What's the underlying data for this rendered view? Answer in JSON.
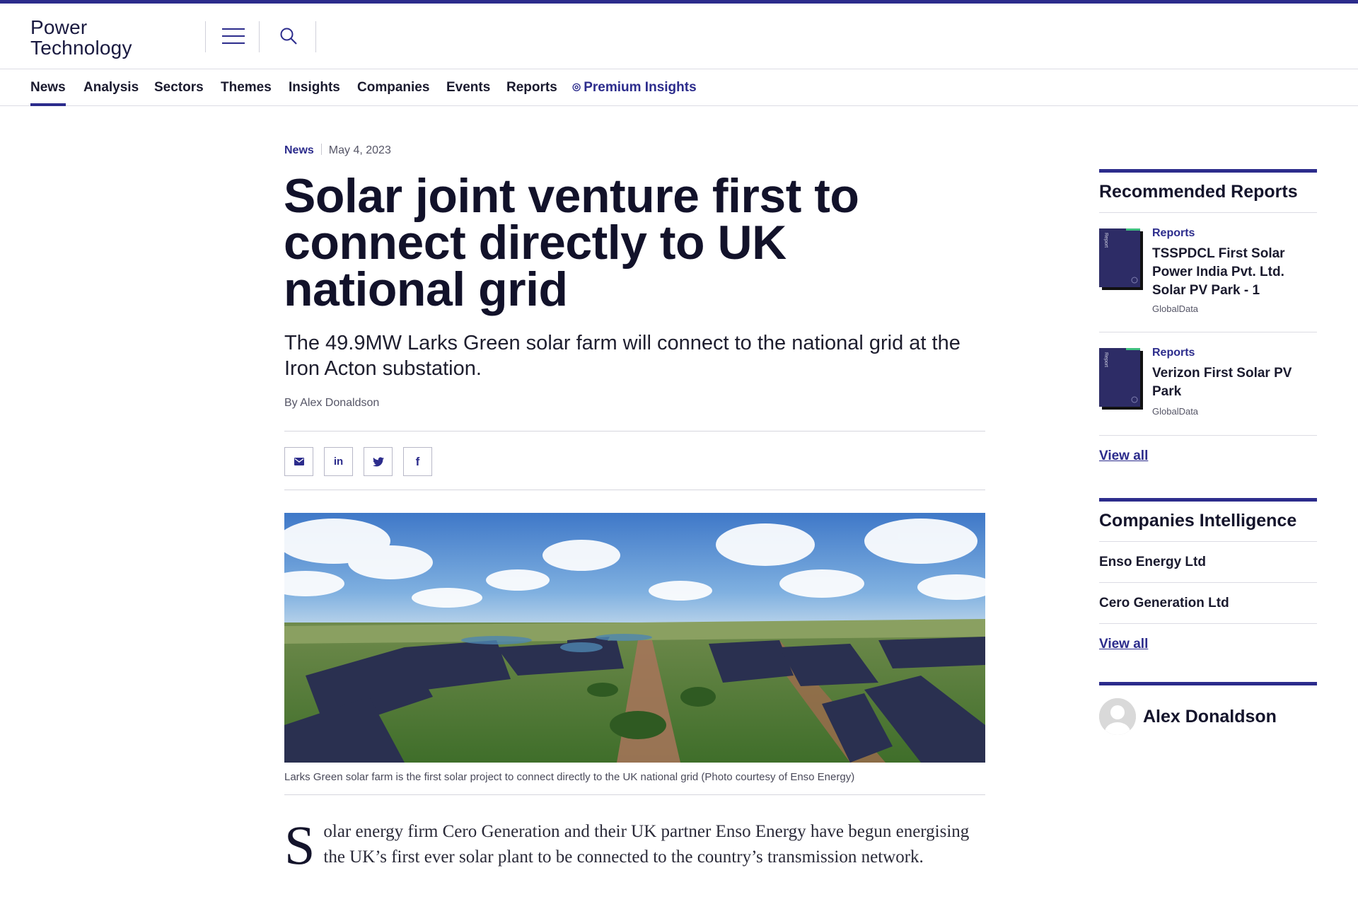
{
  "site": {
    "logo_line1": "Power",
    "logo_line2": "Technology"
  },
  "header": {
    "menu_icon": "hamburger-menu-icon",
    "search_icon": "search-icon"
  },
  "nav": {
    "items": [
      "News",
      "Analysis",
      "Sectors",
      "Themes",
      "Insights",
      "Companies",
      "Events",
      "Reports"
    ],
    "premium": "Premium Insights",
    "active": "News"
  },
  "article": {
    "category": "News",
    "date": "May 4, 2023",
    "headline": "Solar joint venture first to connect directly to UK national grid",
    "standfirst": "The 49.9MW Larks Green solar farm will connect to the national grid at the Iron Acton substation.",
    "byline": "By Alex Donaldson",
    "share_icons": [
      "email-icon",
      "linkedin-icon",
      "twitter-icon",
      "facebook-icon"
    ],
    "share_glyphs": {
      "linkedin": "in",
      "facebook": "f"
    },
    "image_caption": "Larks Green solar farm is the first solar project to connect directly to the UK national grid (Photo courtesy of Enso Energy)",
    "dropcap": "S",
    "body_first": "olar energy firm Cero Generation and their UK partner Enso Energy have begun energising the UK’s first ever solar plant to be connected to the country’s transmission network."
  },
  "sidebar": {
    "recommended_title": "Recommended Reports",
    "reports": [
      {
        "category": "Reports",
        "title": "TSSPDCL First Solar Power India Pvt. Ltd. Solar PV Park - 1",
        "source": "GlobalData",
        "thumb_label": "Report"
      },
      {
        "category": "Reports",
        "title": "Verizon First Solar PV Park",
        "source": "GlobalData",
        "thumb_label": "Report"
      }
    ],
    "view_all": "View all",
    "companies_title": "Companies Intelligence",
    "companies": [
      "Enso Energy Ltd",
      "Cero Generation Ltd"
    ],
    "companies_view_all": "View all",
    "author": "Alex Donaldson"
  },
  "colors": {
    "brand": "#2c2c8c",
    "accent_green": "#3fbf7f",
    "text": "#14142b"
  }
}
